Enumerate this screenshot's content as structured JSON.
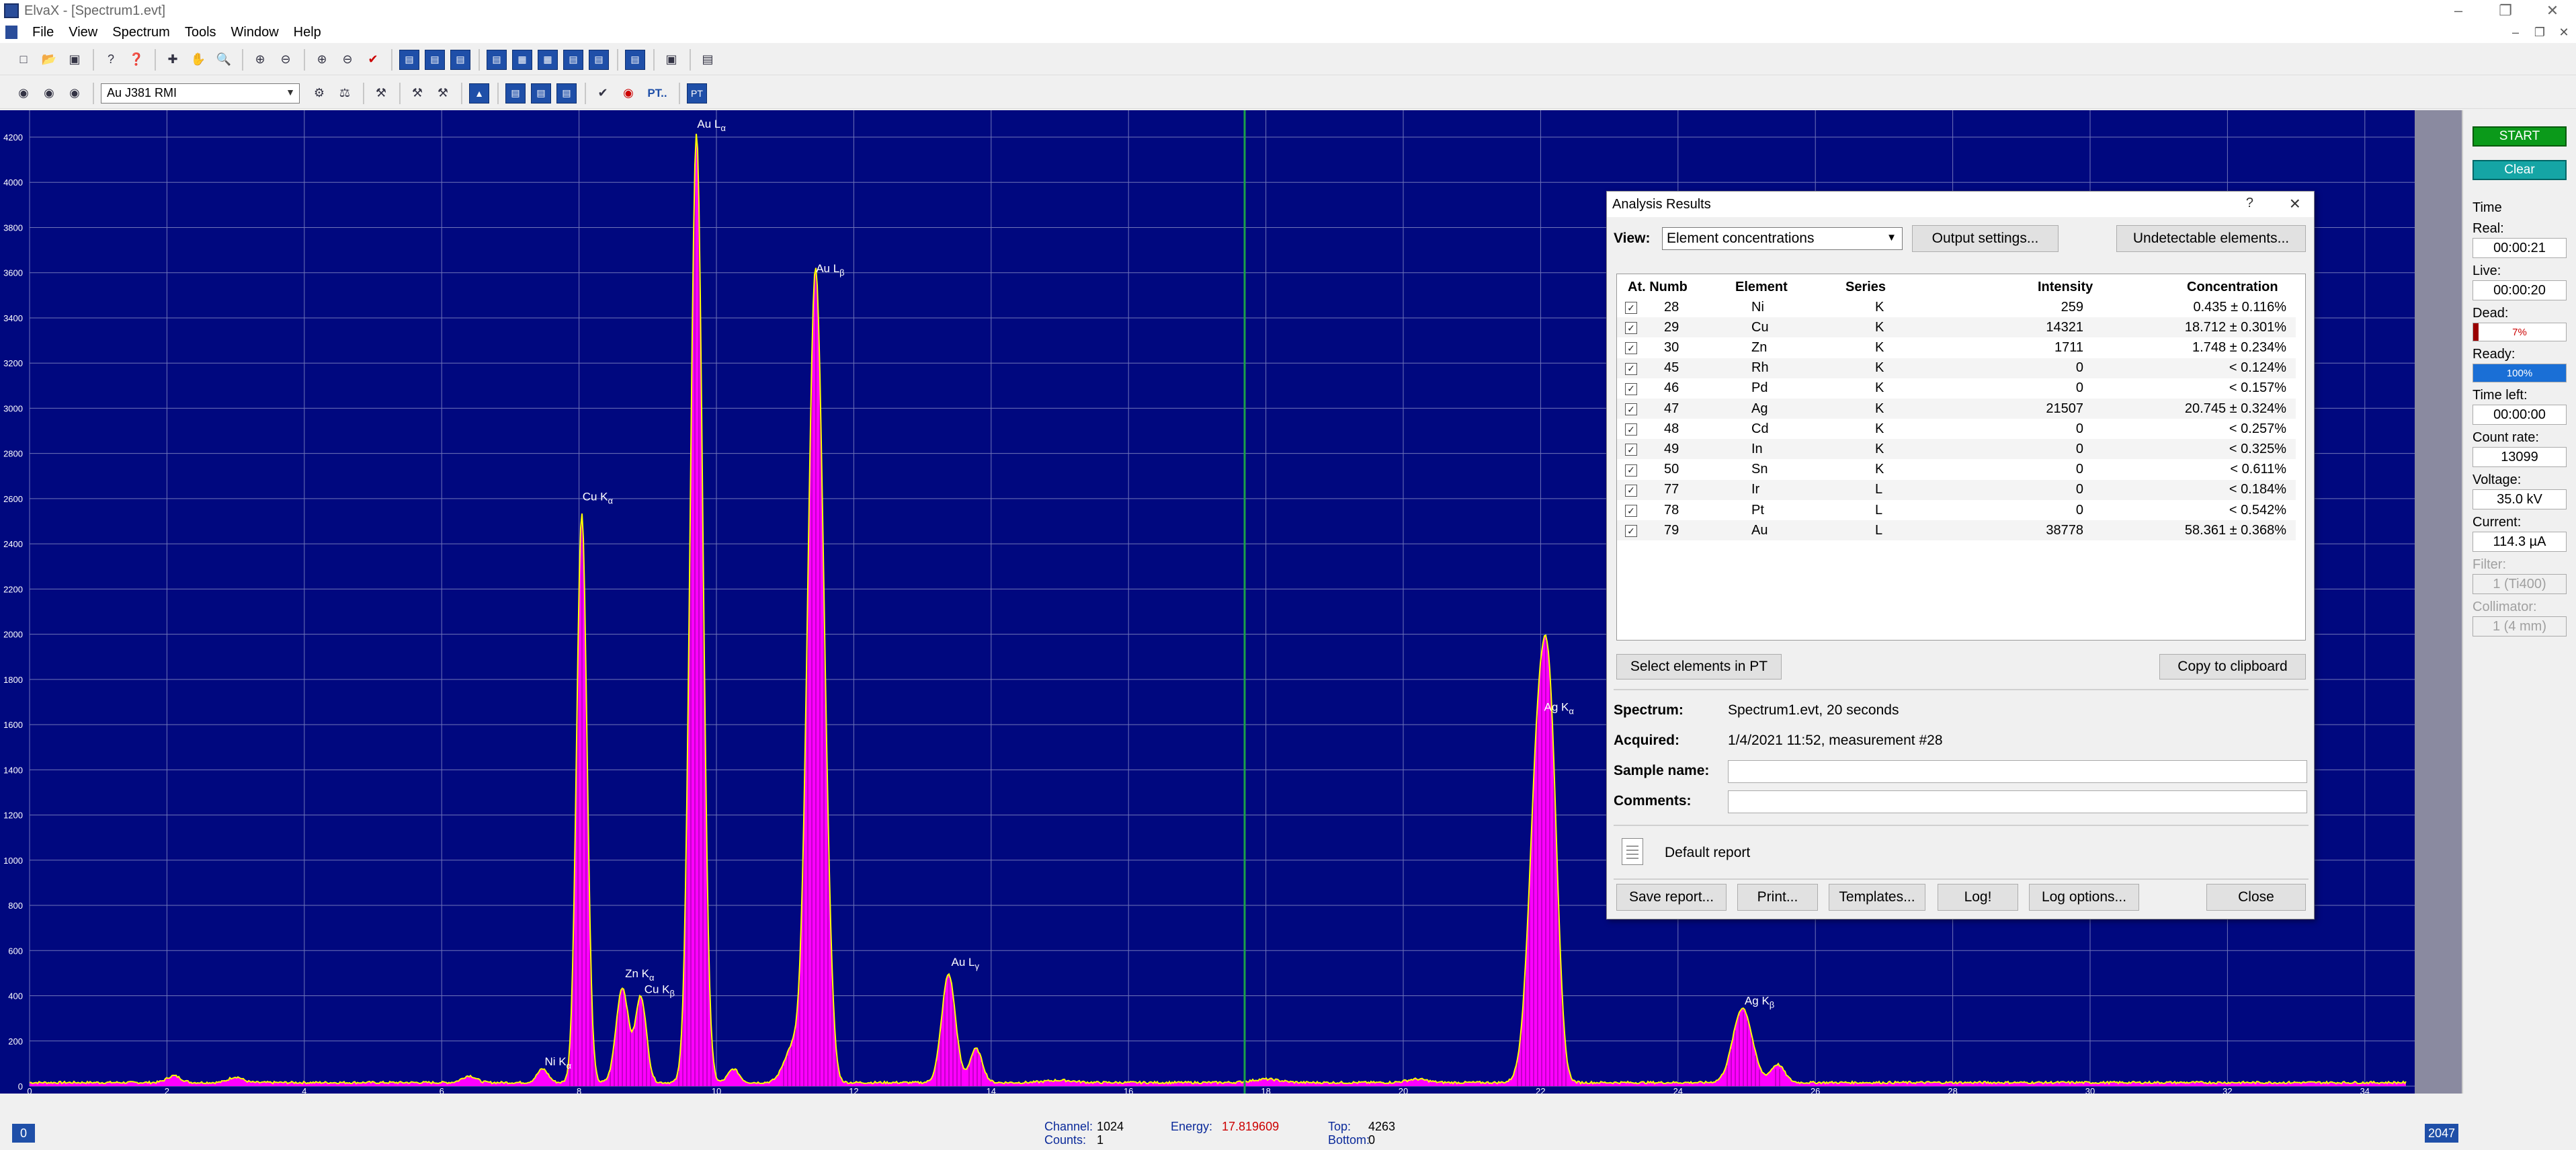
{
  "window": {
    "title": "ElvaX - [Spectrum1.evt]",
    "menu": [
      "File",
      "View",
      "Spectrum",
      "Tools",
      "Window",
      "Help"
    ]
  },
  "toolbar2": {
    "method": "Au J381 RMI",
    "pt_label": "PT..",
    "pt_button": "PT"
  },
  "spectrum": {
    "y_ticks": [
      "4200",
      "4000",
      "3800",
      "3600",
      "3400",
      "3200",
      "3000",
      "2800",
      "2600",
      "2400",
      "2200",
      "2000",
      "1800",
      "1600",
      "1400",
      "1200",
      "1000",
      "800",
      "600",
      "400",
      "200",
      "0"
    ],
    "x_ticks": [
      "0",
      "2",
      "4",
      "6",
      "8",
      "10",
      "12",
      "14",
      "16",
      "18",
      "20",
      "22",
      "24",
      "26",
      "28",
      "30",
      "32",
      "34"
    ],
    "peak_labels": [
      "Ni K",
      "Cu K",
      "Zn K",
      "Cu K",
      "Au L",
      "Au L",
      "Au L",
      "Ag K",
      "Ag K"
    ],
    "peak_subs": [
      "α",
      "α",
      "α",
      "β",
      "α",
      "β",
      "γ",
      "α",
      "β"
    ]
  },
  "right_panel": {
    "start": "START",
    "clear": "Clear",
    "time_label": "Time",
    "real_label": "Real:",
    "real_value": "00:00:21",
    "live_label": "Live:",
    "live_value": "00:00:20",
    "dead_label": "Dead:",
    "dead_value": "7%",
    "dead_fraction": 0.07,
    "ready_label": "Ready:",
    "ready_value": "100%",
    "ready_fraction": 1.0,
    "time_left_label": "Time left:",
    "time_left_value": "00:00:00",
    "count_rate_label": "Count rate:",
    "count_rate_value": "13099",
    "voltage_label": "Voltage:",
    "voltage_value": "35.0 kV",
    "current_label": "Current:",
    "current_value": "114.3 µA",
    "filter_label": "Filter:",
    "filter_value": "1 (Ti400)",
    "collimator_label": "Collimator:",
    "collimator_value": "1 (4 mm)"
  },
  "status_bar": {
    "left_nav": "0",
    "right_nav": "2047",
    "channel_label": "Channel:",
    "channel_value": "1024",
    "counts_label": "Counts:",
    "counts_value": "1",
    "energy_label": "Energy:",
    "energy_value": "17.819609",
    "top_label": "Top:",
    "top_value": "4263",
    "bottom_label": "Bottom:",
    "bottom_value": "0"
  },
  "dialog": {
    "title": "Analysis Results",
    "help": "?",
    "view_label": "View:",
    "view_value": "Element concentrations",
    "output_settings": "Output settings...",
    "undetectable": "Undetectable elements...",
    "columns": [
      "At. Numb",
      "Element",
      "Series",
      "Intensity",
      "Concentration"
    ],
    "rows": [
      {
        "num": "28",
        "el": "Ni",
        "series": "K",
        "intensity": "259",
        "conc": "0.435 ± 0.116%"
      },
      {
        "num": "29",
        "el": "Cu",
        "series": "K",
        "intensity": "14321",
        "conc": "18.712 ± 0.301%"
      },
      {
        "num": "30",
        "el": "Zn",
        "series": "K",
        "intensity": "1711",
        "conc": "1.748 ± 0.234%"
      },
      {
        "num": "45",
        "el": "Rh",
        "series": "K",
        "intensity": "0",
        "conc": "< 0.124%"
      },
      {
        "num": "46",
        "el": "Pd",
        "series": "K",
        "intensity": "0",
        "conc": "< 0.157%"
      },
      {
        "num": "47",
        "el": "Ag",
        "series": "K",
        "intensity": "21507",
        "conc": "20.745 ± 0.324%"
      },
      {
        "num": "48",
        "el": "Cd",
        "series": "K",
        "intensity": "0",
        "conc": "< 0.257%"
      },
      {
        "num": "49",
        "el": "In",
        "series": "K",
        "intensity": "0",
        "conc": "< 0.325%"
      },
      {
        "num": "50",
        "el": "Sn",
        "series": "K",
        "intensity": "0",
        "conc": "< 0.611%"
      },
      {
        "num": "77",
        "el": "Ir",
        "series": "L",
        "intensity": "0",
        "conc": "< 0.184%"
      },
      {
        "num": "78",
        "el": "Pt",
        "series": "L",
        "intensity": "0",
        "conc": "< 0.542%"
      },
      {
        "num": "79",
        "el": "Au",
        "series": "L",
        "intensity": "38778",
        "conc": "58.361 ± 0.368%"
      }
    ],
    "select_pt": "Select elements in PT",
    "copy_clipboard": "Copy to clipboard",
    "spectrum_label": "Spectrum:",
    "spectrum_value": "Spectrum1.evt,  20 seconds",
    "acquired_label": "Acquired:",
    "acquired_value": "1/4/2021  11:52,  measurement #28",
    "sample_label": "Sample name:",
    "comments_label": "Comments:",
    "default_report": "Default report",
    "save_report": "Save report...",
    "print": "Print...",
    "templates": "Templates...",
    "log": "Log!",
    "log_options": "Log options...",
    "close": "Close"
  },
  "colors": {
    "spectrum_bg": "#00087f",
    "grid": "#6f74b8",
    "peak_fill": "#ff00ff",
    "trace": "#ffff00"
  }
}
